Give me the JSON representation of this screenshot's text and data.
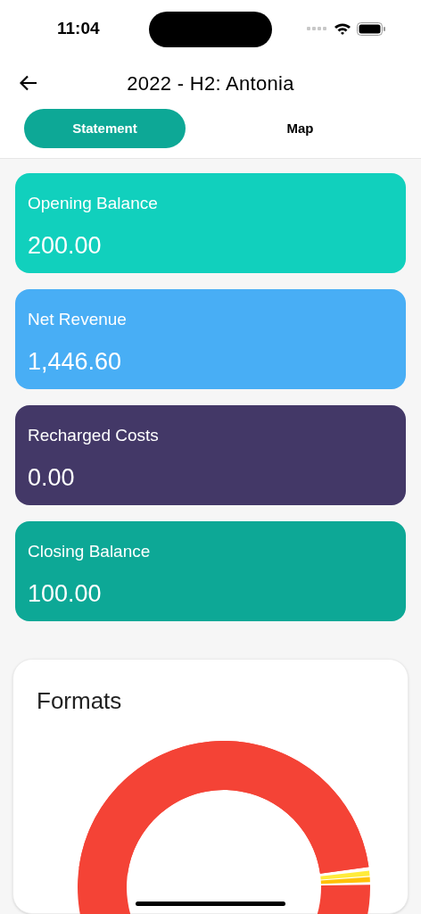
{
  "status_bar": {
    "time": "11:04"
  },
  "header": {
    "title": "2022 - H2: Antonia"
  },
  "tabs": [
    {
      "label": "Statement",
      "selected": true
    },
    {
      "label": "Map",
      "selected": false
    }
  ],
  "balances": [
    {
      "label": "Opening Balance",
      "value": "200.00",
      "color": "#11d0bd"
    },
    {
      "label": "Net Revenue",
      "value": "1,446.60",
      "color": "#48aef5"
    },
    {
      "label": "Recharged Costs",
      "value": "0.00",
      "color": "#433867"
    },
    {
      "label": "Closing Balance",
      "value": "100.00",
      "color": "#0da896"
    }
  ],
  "formats_card": {
    "title": "Formats"
  }
}
